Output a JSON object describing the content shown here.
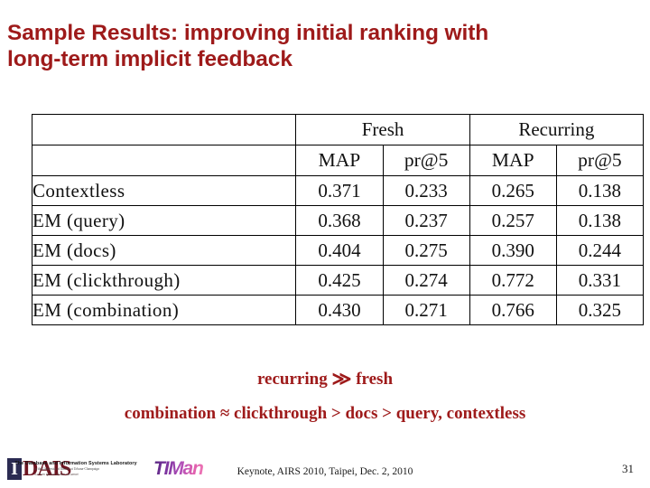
{
  "slide": {
    "title": "Sample Results: improving initial ranking with\nlong-term  implicit feedback",
    "title_color": "#9e1a1a",
    "page_number": "31",
    "footer_note": "Keynote, AIRS 2010, Taipei, Dec. 2, 2010"
  },
  "table": {
    "corner_blank": "",
    "group_headers": [
      {
        "label": "Fresh",
        "span": 2
      },
      {
        "label": "Recurring",
        "span": 2
      }
    ],
    "metric_headers": [
      "MAP",
      "pr@5",
      "MAP",
      "pr@5"
    ],
    "rows": [
      {
        "label": "Contextless",
        "values": [
          "0.371",
          "0.233",
          "0.265",
          "0.138"
        ]
      },
      {
        "label": "EM (query)",
        "values": [
          "0.368",
          "0.237",
          "0.257",
          "0.138"
        ]
      },
      {
        "label": "EM (docs)",
        "values": [
          "0.404",
          "0.275",
          "0.390",
          "0.244"
        ]
      },
      {
        "label": "EM (clickthrough)",
        "values": [
          "0.425",
          "0.274",
          "0.772",
          "0.331"
        ]
      },
      {
        "label": "EM (combination)",
        "values": [
          "0.430",
          "0.271",
          "0.766",
          "0.325"
        ]
      }
    ]
  },
  "conclusions": {
    "line1_before": "recurring",
    "line1_symbol": "≫",
    "line1_after": "fresh",
    "line2": "combination ≈ clickthrough > docs > query, contextless"
  },
  "logos": {
    "dais": {
      "initial": "I",
      "word": "DAIS",
      "sub_line1": "The Database and Information Systems Laboratory",
      "sub_line2": "at the University of Illinois at Urbana-Champaign",
      "sub_line3": "Lorem ipsum dolor sit amet"
    },
    "timan": {
      "word": "TIMan"
    }
  }
}
